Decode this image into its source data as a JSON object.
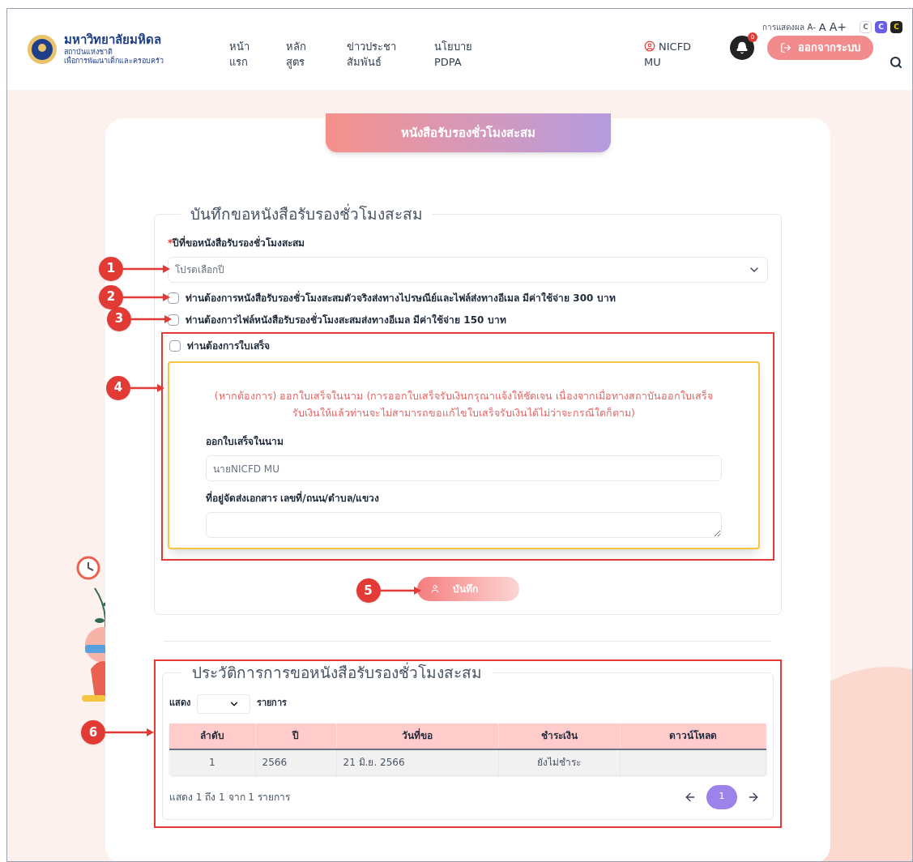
{
  "header": {
    "logo_title": "มหาวิทยาลัยมหิดล",
    "logo_lines": [
      "สถาบันแห่งชาติ",
      "เพื่อการพัฒนาเด็กและครอบครัว"
    ],
    "display_label": "การแสดงผล",
    "font_sizes": [
      "A-",
      "A",
      "A+"
    ],
    "contrast": [
      {
        "label": "C",
        "kind": "light"
      },
      {
        "label": "C",
        "kind": "purple"
      },
      {
        "label": "C",
        "kind": "dark"
      }
    ],
    "nav": [
      {
        "lines": [
          "หน้า",
          "แรก"
        ]
      },
      {
        "lines": [
          "หลัก",
          "สูตร"
        ]
      },
      {
        "lines": [
          "ข่าวประชา",
          "สัมพันธ์"
        ]
      },
      {
        "lines": [
          "นโยบาย",
          "PDPA"
        ]
      }
    ],
    "user": [
      "NICFD",
      "MU"
    ],
    "notification_count": "0",
    "logout": "ออกจากระบบ"
  },
  "card_title": "หนังสือรับรองชั่วโมงสะสม",
  "form": {
    "legend": "บันทึกขอหนังสือรับรองชั่วโมงสะสม",
    "required_mark": "*",
    "year_label": "ปีที่ขอหนังสือรับรองชั่วโมงสะสม",
    "year_placeholder": "โปรดเลือกปี",
    "options": [
      {
        "label": "ท่านต้องการหนังสือรับรองชั่วโมงสะสมตัวจริงส่งทางไปรษณีย์และไฟล์ส่งทางอีเมล มีค่าใช้จ่าย 300 บาท",
        "checked": false
      },
      {
        "label": "ท่านต้องการไฟล์หนังสือรับรองชั่วโมงสะสมส่งทางอีเมล มีค่าใช้จ่าย 150 บาท",
        "checked": false
      },
      {
        "label": "ท่านต้องการใบเสร็จ",
        "checked": false
      }
    ],
    "receipt_notice": "(หากต้องการ) ออกใบเสร็จในนาม (การออกใบเสร็จรับเงินกรุณาแจ้งให้ชัดเจน เนื่องจากเมื่อทางสถาบันออกใบเสร็จรับเงินให้แล้วท่านจะไม่สามารถขอแก้ไขใบเสร็จรับเงินได้ไม่ว่าจะกรณีใดก็ตาม)",
    "name_label": "ออกใบเสร็จในนาม",
    "name_value": "นายNICFD MU",
    "address_label": "ที่อยู่จัดส่งเอกสาร เลขที่/ถนน/ตำบล/แขวง",
    "save": "บันทึก"
  },
  "history": {
    "legend": "ประวัติการการขอหนังสือรับรองชั่วโมงสะสม",
    "show_label": "แสดง",
    "entries_label": "รายการ",
    "columns": [
      "ลำดับ",
      "ปี",
      "วันที่ขอ",
      "ชำระเงิน",
      "ดาวน์โหลด"
    ],
    "rows": [
      [
        "1",
        "2566",
        "21 มิ.ย. 2566",
        "ยังไม่ชำระ",
        ""
      ]
    ],
    "info": "แสดง 1 ถึง 1 จาก 1 รายการ",
    "pages": [
      {
        "label": "1",
        "selected": true
      }
    ]
  },
  "callouts": [
    "1",
    "2",
    "3",
    "4",
    "5",
    "6"
  ]
}
